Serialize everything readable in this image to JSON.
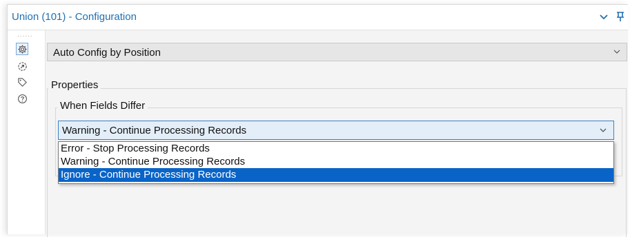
{
  "window": {
    "title": "Union (101) - Configuration",
    "icons": {
      "collapse": "chevron-down-icon",
      "pin": "pin-icon"
    }
  },
  "sidebar": {
    "grip": "......",
    "items": [
      {
        "icon": "gear-icon",
        "active": true
      },
      {
        "icon": "arrow-circle-icon",
        "active": false
      },
      {
        "icon": "tag-icon",
        "active": false
      },
      {
        "icon": "help-icon",
        "active": false
      }
    ]
  },
  "config": {
    "mode_select": {
      "selected": "Auto Config by Position"
    },
    "properties": {
      "label": "Properties",
      "when_fields_differ": {
        "label": "When Fields Differ",
        "selected": "Warning - Continue Processing Records",
        "options": [
          "Error - Stop Processing Records",
          "Warning - Continue Processing Records",
          "Ignore - Continue Processing Records"
        ],
        "highlighted": "Ignore - Continue Processing Records"
      }
    }
  },
  "colors": {
    "accent": "#1f6fb2",
    "highlight": "#0a64c8",
    "dropdown_bg": "#e3eef9",
    "panel_bg": "#f4f4f4"
  }
}
